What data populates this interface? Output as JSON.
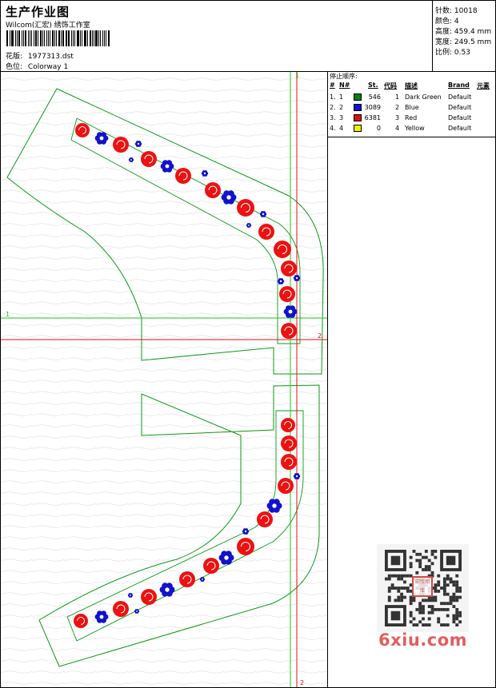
{
  "header": {
    "title": "生产作业图",
    "subtitle": "Wilcom(汇宏) 绣饰工作室",
    "pattern_label": "花版:",
    "pattern_value": "1977313.dst",
    "colorway_label": "色位:",
    "colorway_value": "Colorway 1"
  },
  "stats": [
    {
      "label": "针数:",
      "value": "10018"
    },
    {
      "label": "颜色:",
      "value": "4"
    },
    {
      "label": "高度:",
      "value": "459.4 mm"
    },
    {
      "label": "宽度:",
      "value": "249.5 mm"
    },
    {
      "label": "比例:",
      "value": "0.53"
    }
  ],
  "sequence": {
    "title": "停止顺序:",
    "headers": [
      "#",
      "N#",
      "St.",
      "代码",
      "描述",
      "Brand",
      "元素"
    ],
    "rows": [
      {
        "idx": "1.",
        "n": "1",
        "color": "#0a7f14",
        "st": "546",
        "code": "1",
        "desc": "Dark Green",
        "brand": "Default"
      },
      {
        "idx": "2.",
        "n": "2",
        "color": "#1010d8",
        "st": "3089",
        "code": "2",
        "desc": "Blue",
        "brand": "Default"
      },
      {
        "idx": "3.",
        "n": "3",
        "color": "#e01010",
        "st": "6381",
        "code": "3",
        "desc": "Red",
        "brand": "Default"
      },
      {
        "idx": "4.",
        "n": "4",
        "color": "#f2f200",
        "st": "0",
        "code": "4",
        "desc": "Yellow",
        "brand": "Default"
      }
    ]
  },
  "guides": {
    "h1_label": "1",
    "h2_label": "2",
    "v1_label": "1",
    "v2_label": "2"
  },
  "colors": {
    "outline": "#0a9a14",
    "guide_green": "#22c022",
    "guide_red": "#e01010",
    "motif_red": "#ee1111",
    "motif_blue": "#1212cc"
  },
  "watermark": {
    "site": "6xiu.com",
    "stamp": "印版图库"
  }
}
